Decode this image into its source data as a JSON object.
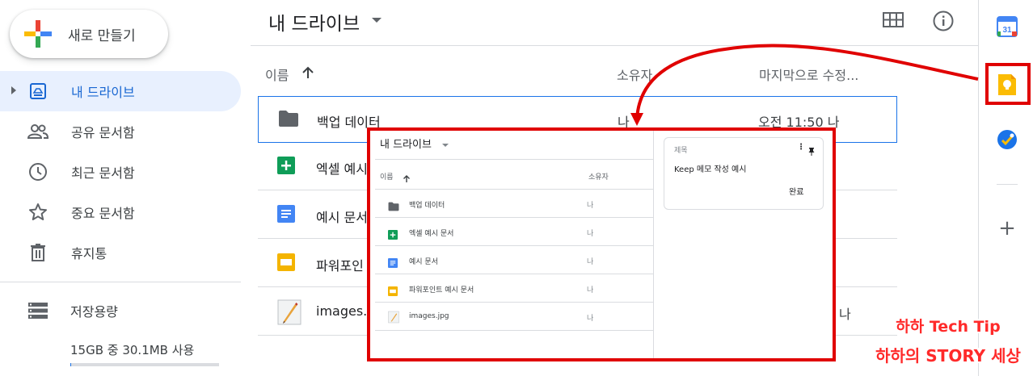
{
  "sidebar": {
    "new_button": "새로 만들기",
    "items": [
      {
        "label": "내 드라이브",
        "icon": "drive-icon",
        "active": true
      },
      {
        "label": "공유 문서함",
        "icon": "people-icon"
      },
      {
        "label": "최근 문서함",
        "icon": "clock-icon"
      },
      {
        "label": "중요 문서함",
        "icon": "star-icon"
      },
      {
        "label": "휴지통",
        "icon": "trash-icon"
      }
    ],
    "storage": {
      "label": "저장용량",
      "usage": "15GB 중 30.1MB 사용",
      "fraction_used": 0.002
    }
  },
  "main": {
    "title": "내 드라이브",
    "columns": {
      "name": "이름",
      "owner": "소유자",
      "modified": "마지막으로 수정..."
    },
    "files": [
      {
        "name": "백업 데이터",
        "icon": "folder-icon",
        "owner": "나",
        "modified": "오전 11:50 나"
      },
      {
        "name": "엑셀 예시",
        "icon": "sheets-icon",
        "owner": "",
        "modified": ""
      },
      {
        "name": "예시 문서",
        "icon": "docs-icon",
        "owner": "",
        "modified": ""
      },
      {
        "name": "파워포인",
        "icon": "slides-icon",
        "owner": "",
        "modified": ""
      },
      {
        "name": "images.jp",
        "icon": "image-icon",
        "owner": "",
        "modified": "나"
      }
    ]
  },
  "rail": {
    "items": [
      {
        "name": "calendar-icon",
        "text": "31"
      },
      {
        "name": "keep-icon"
      },
      {
        "name": "tasks-icon"
      },
      {
        "name": "add-icon",
        "text": "+"
      }
    ]
  },
  "inset": {
    "title": "내 드라이브",
    "columns": {
      "name": "이름",
      "owner": "소유자"
    },
    "files": [
      {
        "name": "백업 데이터",
        "icon": "folder-icon",
        "owner": "나"
      },
      {
        "name": "엑셀 예시 문서",
        "icon": "sheets-icon",
        "owner": "나"
      },
      {
        "name": "예시 문서",
        "icon": "docs-icon",
        "owner": "나"
      },
      {
        "name": "파워포인트 예시 문서",
        "icon": "slides-icon",
        "owner": "나"
      },
      {
        "name": "images.jpg",
        "icon": "image-icon",
        "owner": "나"
      }
    ],
    "keep": {
      "title": "제목",
      "note": "Keep 메모 작성 예시",
      "done": "완료"
    }
  },
  "watermark": {
    "line1": "하하 Tech Tip",
    "line2": "하하의 STORY 세상"
  },
  "colors": {
    "accent": "#1a73e8",
    "highlight": "#e00000",
    "active_bg": "#e8f0fe"
  }
}
